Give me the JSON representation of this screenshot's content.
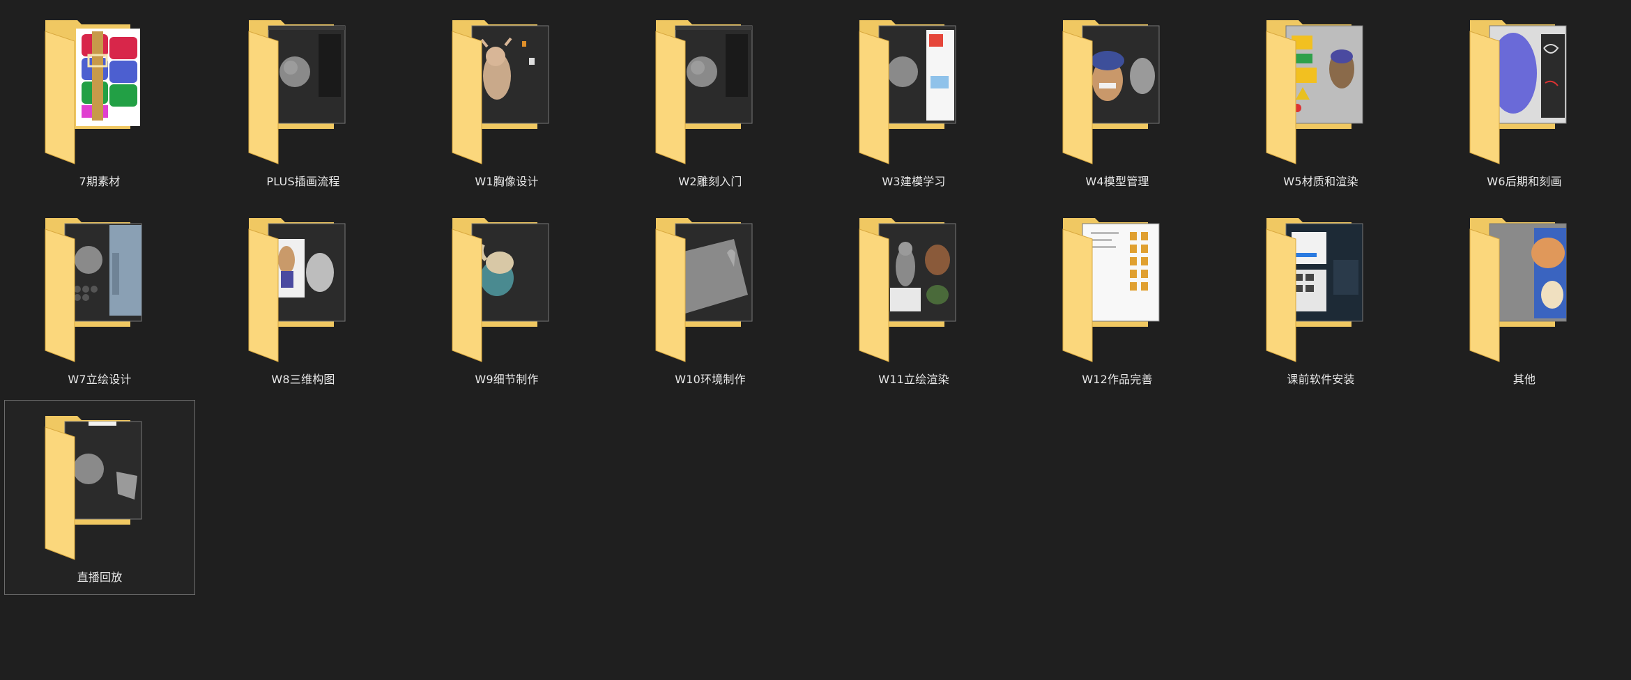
{
  "folders": [
    {
      "name": "7期素材",
      "preview": "winrar"
    },
    {
      "name": "PLUS插画流程",
      "preview": "sphere-dark"
    },
    {
      "name": "W1胸像设计",
      "preview": "character-tan"
    },
    {
      "name": "W2雕刻入门",
      "preview": "sphere-dark"
    },
    {
      "name": "W3建模学习",
      "preview": "sphere-light"
    },
    {
      "name": "W4模型管理",
      "preview": "character-blue"
    },
    {
      "name": "W5材质和渲染",
      "preview": "signs"
    },
    {
      "name": "W6后期和刻画",
      "preview": "purple-circle"
    },
    {
      "name": "W7立绘设计",
      "preview": "sphere-city"
    },
    {
      "name": "W8三维构图",
      "preview": "character-gray"
    },
    {
      "name": "W9细节制作",
      "preview": "character-teal"
    },
    {
      "name": "W10环境制作",
      "preview": "gray-block"
    },
    {
      "name": "W11立绘渲染",
      "preview": "statue"
    },
    {
      "name": "W12作品完善",
      "preview": "file-grid"
    },
    {
      "name": "课前软件安装",
      "preview": "screenshots"
    },
    {
      "name": "其他",
      "preview": "orange-art"
    },
    {
      "name": "直播回放",
      "preview": "sphere-plane",
      "selected": true
    }
  ],
  "colors": {
    "background": "#1f1f1f",
    "folder_back": "#f0c862",
    "folder_front": "#fbd77c",
    "label": "#e8e8e8",
    "selection_border": "#6b6b6b"
  }
}
